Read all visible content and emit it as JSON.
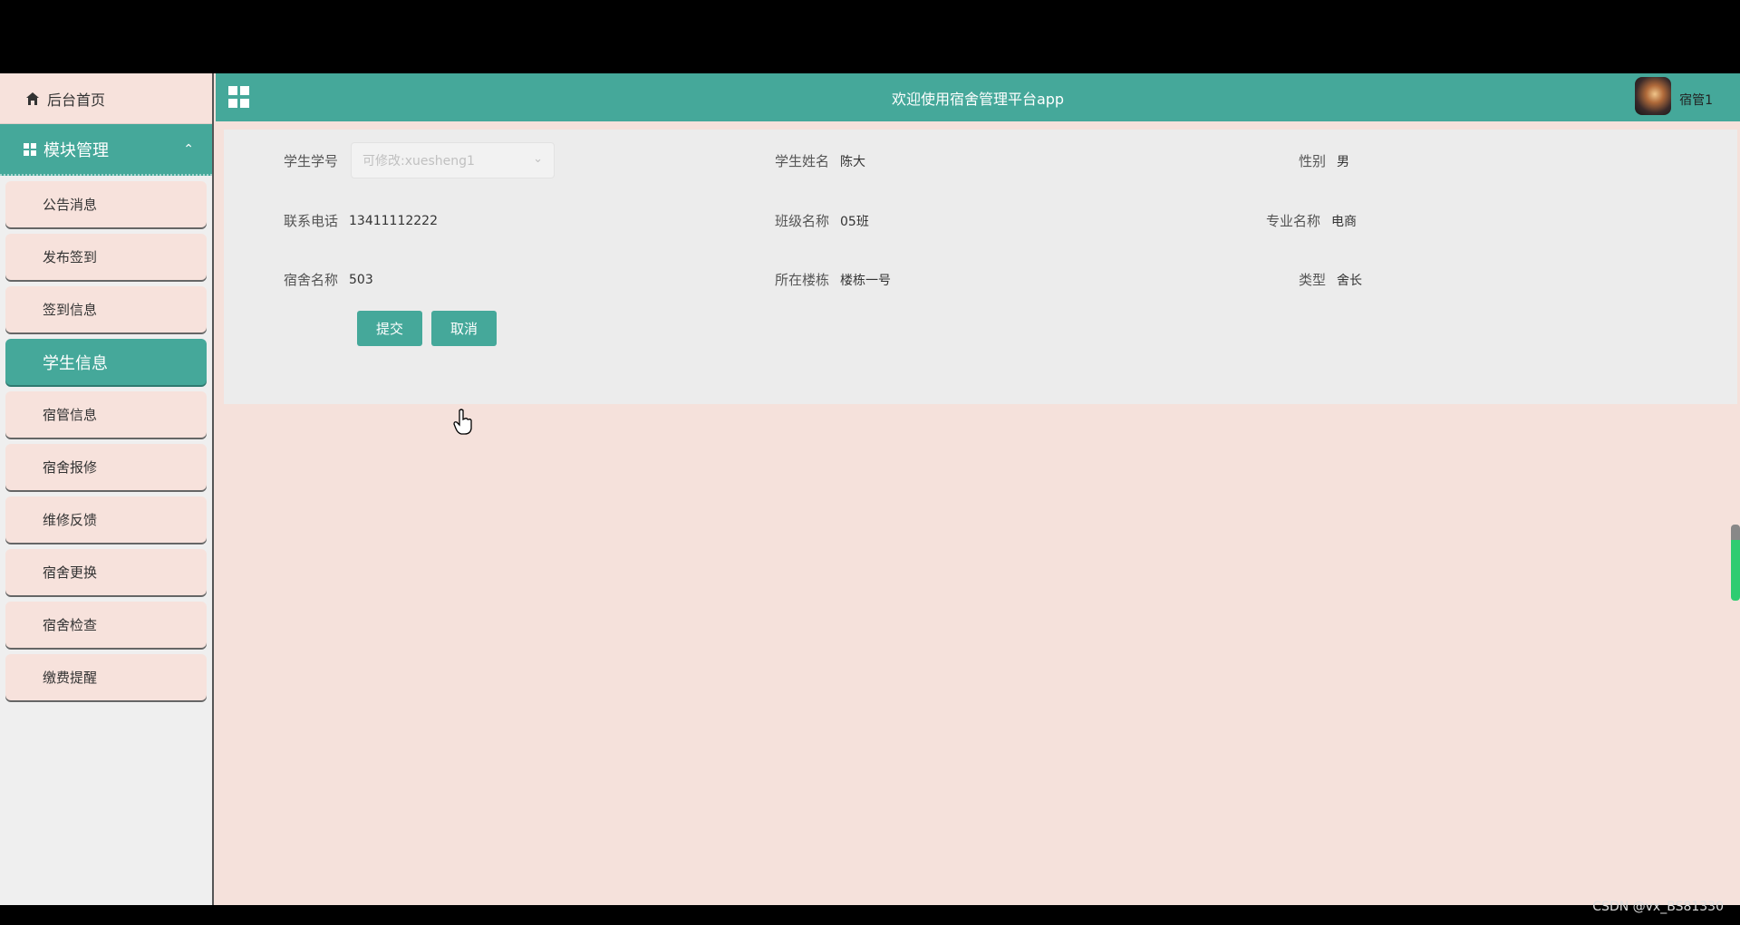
{
  "header": {
    "title": "欢迎使用宿舍管理平台app",
    "username": "宿管1"
  },
  "sidebar": {
    "home_label": "后台首页",
    "module_label": "模块管理",
    "items": [
      {
        "label": "公告消息"
      },
      {
        "label": "发布签到"
      },
      {
        "label": "签到信息"
      },
      {
        "label": "学生信息"
      },
      {
        "label": "宿管信息"
      },
      {
        "label": "宿舍报修"
      },
      {
        "label": "维修反馈"
      },
      {
        "label": "宿舍更换"
      },
      {
        "label": "宿舍检查"
      },
      {
        "label": "缴费提醒"
      }
    ],
    "active_item": "学生信息"
  },
  "form": {
    "student_no": {
      "label": "学生学号",
      "placeholder": "可修改:xuesheng1"
    },
    "student_name": {
      "label": "学生姓名",
      "value": "陈大"
    },
    "gender": {
      "label": "性别",
      "value": "男"
    },
    "phone": {
      "label": "联系电话",
      "value": "13411112222"
    },
    "class_name": {
      "label": "班级名称",
      "value": "05班"
    },
    "major": {
      "label": "专业名称",
      "value": "电商"
    },
    "dorm": {
      "label": "宿舍名称",
      "value": "503"
    },
    "building": {
      "label": "所在楼栋",
      "value": "楼栋一号"
    },
    "type": {
      "label": "类型",
      "value": "舍长"
    },
    "submit_label": "提交",
    "cancel_label": "取消"
  },
  "watermark": "CSDN @vx_BS81330",
  "colors": {
    "accent": "#45a89a",
    "background": "#f5e1db",
    "sidebar_bg": "#efefef"
  }
}
